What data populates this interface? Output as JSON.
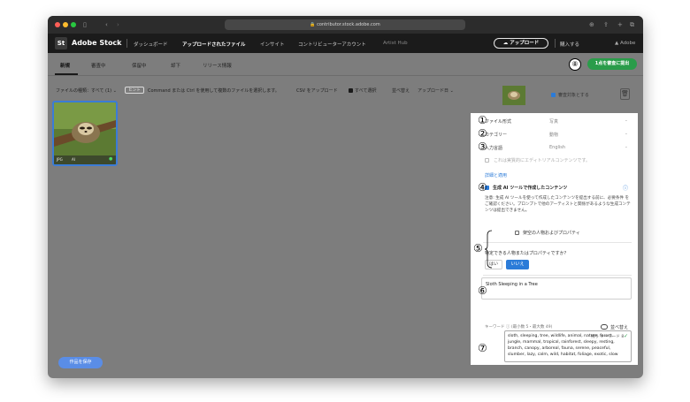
{
  "browser": {
    "url": "contributor.stock.adobe.com"
  },
  "app": {
    "brand": "Adobe Stock",
    "logo": "St",
    "nav": [
      "ダッシュボード",
      "アップロードされたファイル",
      "インサイト",
      "コントリビューターアカウント",
      "Artist Hub"
    ],
    "upload_button": "アップロード",
    "buy_link": "購入する",
    "adobe_link": "Adobe"
  },
  "tabs": [
    "新規",
    "審査中",
    "保留中",
    "却下",
    "リリース情報"
  ],
  "submit_button": "1点を審査に提出",
  "toolbar": {
    "file_type": "ファイルの種類：すべて (1) ⌄",
    "hint": "ヒント",
    "hint_text": "Command または Ctrl を使用して複数のファイルを選択します。",
    "csv_upload": "CSV をアップロード",
    "select_all": "すべて選択",
    "sort": "並べ替え",
    "sort_value": "アップロード日 ⌄"
  },
  "thumb": {
    "tags": [
      "JPG",
      "AI"
    ]
  },
  "save_work": "作品を保存",
  "panel": {
    "select_for_review": "審査対象とする",
    "file_type_label": "ファイル形式",
    "file_type_value": "写真",
    "category_label": "カテゴリー",
    "category_value": "動物",
    "language_label": "入力言語",
    "language_value": "English",
    "editorial": "これは実質的にエディトリアルコンテンツです。",
    "details_link": "詳細と適用",
    "genai": "生成 AI ツールで作成したコンテンツ",
    "notice": "注意: 生成 AI ツールを使って作成したコンテンツを提出する前に、必要条件 をご確認ください。プロンプトで他のアーティストと関係があるような生成コンテンツは提出できません。",
    "fictional": "架空の人物およびプロパティ",
    "identifiable_q": "特定できる人物またはプロパティですか？",
    "no": "はい",
    "yes": "いいえ",
    "title_value": "Sloth Sleeping in a Tree",
    "keyword_label": "キーワード ⓘ (最小数 5・最大数 49)",
    "sort_toggle": "並べ替え",
    "remaining": "残り キーワード 8",
    "keywords": "sloth, sleeping, tree, wildlife, animal, nature, forest, jungle, mammal, tropical, rainforest, sleepy, resting, branch, canopy, arboreal, fauna, serene, peaceful, slumber, lazy, calm, wild, habitat, foliage, exotic, slow"
  },
  "annotations": [
    "①",
    "②",
    "③",
    "④",
    "⑤",
    "⑥",
    "⑦",
    "⑧"
  ]
}
